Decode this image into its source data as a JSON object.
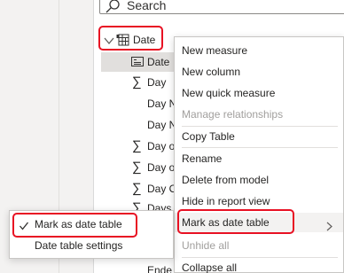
{
  "search": {
    "placeholder": "Search"
  },
  "tree": {
    "table_name": "Date",
    "fields": [
      "Date",
      "Day",
      "Day N",
      "Day N",
      "Day o",
      "Day o",
      "Day O",
      "Days",
      "Ende"
    ]
  },
  "context_menu": {
    "items": [
      {
        "label": "New measure",
        "disabled": false
      },
      {
        "label": "New column",
        "disabled": false
      },
      {
        "label": "New quick measure",
        "disabled": false
      },
      {
        "label": "Manage relationships",
        "disabled": true
      },
      {
        "label": "Copy Table",
        "disabled": false
      },
      {
        "label": "Rename",
        "disabled": false
      },
      {
        "label": "Delete from model",
        "disabled": false
      },
      {
        "label": "Hide in report view",
        "disabled": false
      },
      {
        "label": "Mark as date table",
        "disabled": false,
        "submenu": true
      },
      {
        "label": "Unhide all",
        "disabled": true
      },
      {
        "label": "Collapse all",
        "disabled": false
      }
    ]
  },
  "submenu": {
    "items": [
      {
        "label": "Mark as date table",
        "checked": true
      },
      {
        "label": "Date table settings",
        "checked": false
      }
    ]
  },
  "colors": {
    "highlight": "#e81123",
    "selected_row": "#e1dfdd",
    "disabled_text": "#a19f9d"
  }
}
